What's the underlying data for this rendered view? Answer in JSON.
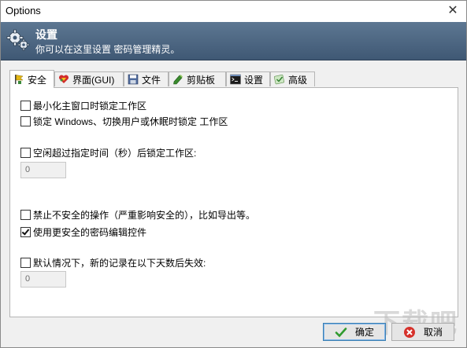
{
  "window": {
    "title": "Options",
    "close_glyph": "✕"
  },
  "header": {
    "title": "设置",
    "description": "你可以在这里设置 密码管理精灵。",
    "icon": "gears-icon"
  },
  "tabs": [
    {
      "label": "安全",
      "icon": "security-flag-icon"
    },
    {
      "label": "界面(GUI)",
      "icon": "heart-icon"
    },
    {
      "label": "文件",
      "icon": "floppy-disk-icon"
    },
    {
      "label": "剪贴板",
      "icon": "clipboard-icon"
    },
    {
      "label": "设置",
      "icon": "terminal-icon"
    },
    {
      "label": "高级",
      "icon": "advanced-icon"
    }
  ],
  "security": {
    "lock_on_minimize": {
      "label": "最小化主窗口时锁定工作区",
      "checked": false
    },
    "lock_on_switch": {
      "label": "锁定 Windows、切换用户或休眠时锁定 工作区",
      "checked": false
    },
    "lock_idle": {
      "label": "空闲超过指定时间（秒）后锁定工作区:",
      "checked": false,
      "value": "0"
    },
    "block_unsafe": {
      "label": "禁止不安全的操作（严重影响安全的），比如导出等。",
      "checked": false
    },
    "secure_edit": {
      "label": "使用更安全的密码编辑控件",
      "checked": true
    },
    "default_expiry": {
      "label": "默认情况下，新的记录在以下天数后失效:",
      "checked": false,
      "value": "0"
    }
  },
  "buttons": {
    "ok": "确定",
    "cancel": "取消"
  },
  "watermark": "下载吧"
}
